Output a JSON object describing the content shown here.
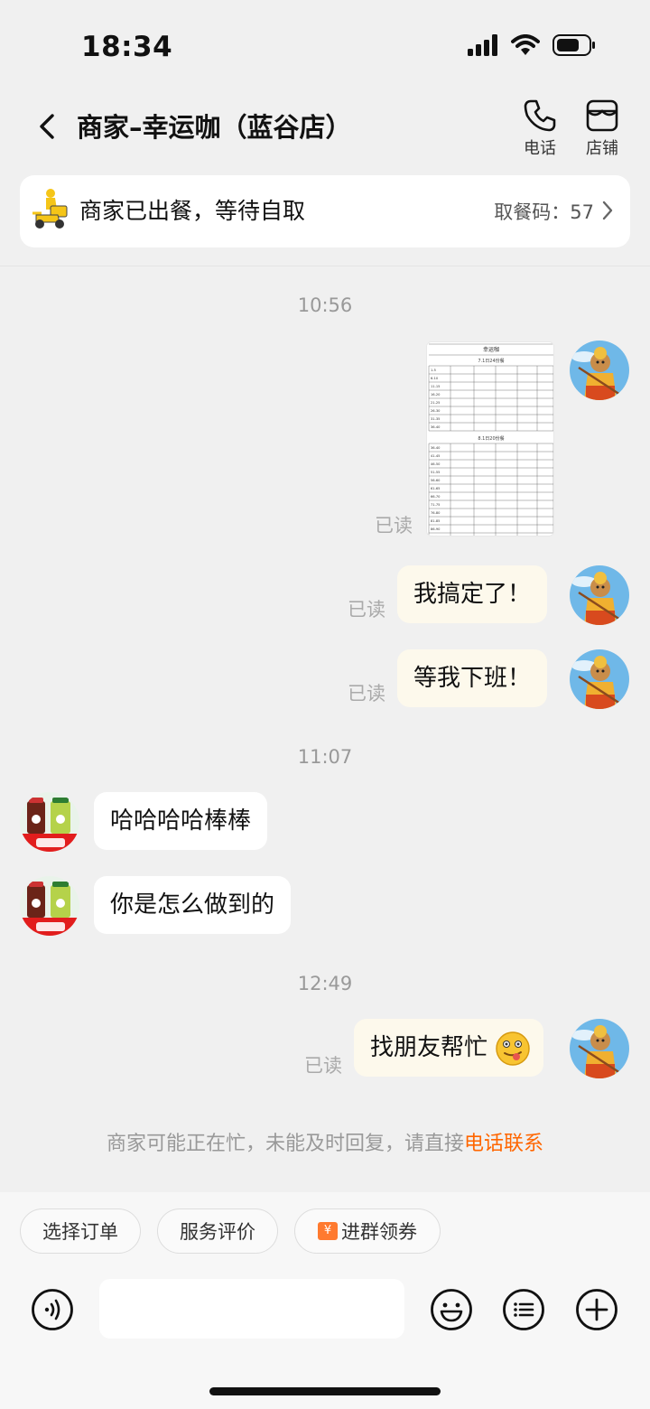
{
  "status_bar": {
    "time": "18:34"
  },
  "header": {
    "title": "商家–幸运咖（蓝谷店）",
    "actions": {
      "phone_label": "电话",
      "store_label": "店铺"
    }
  },
  "order": {
    "status": "商家已出餐，等待自取",
    "pickup_code": "取餐码：57"
  },
  "messages": {
    "time1": "10:56",
    "read": "已读",
    "msg_done": "我搞定了！",
    "msg_wait": "等我下班！",
    "time2": "11:07",
    "msg_haha": "哈哈哈哈棒棒",
    "msg_how": "你是怎么做到的",
    "time3": "12:49",
    "msg_friend": "找朋友帮忙"
  },
  "notice": {
    "text": "商家可能正在忙，未能及时回复，请直接",
    "link": "电话联系"
  },
  "quick_actions": {
    "select_order": "选择订单",
    "rate_service": "服务评价",
    "coupon_glyph": "¥",
    "join_group": "进群领券"
  },
  "input": {
    "placeholder": ""
  },
  "image_doc": {
    "title": "幸运咖",
    "sub1": "7.1日24份餐",
    "sub2": "8.1日20份餐",
    "rows1": [
      "1-5",
      "6-10",
      "11-15",
      "16-20",
      "21-25",
      "26-30",
      "31-35",
      "36-40"
    ],
    "rows2": [
      "36-40",
      "41-45",
      "46-50",
      "51-55",
      "56-60",
      "61-65",
      "66-70",
      "71-75",
      "76-80",
      "81-85",
      "86-90",
      "合计"
    ]
  }
}
